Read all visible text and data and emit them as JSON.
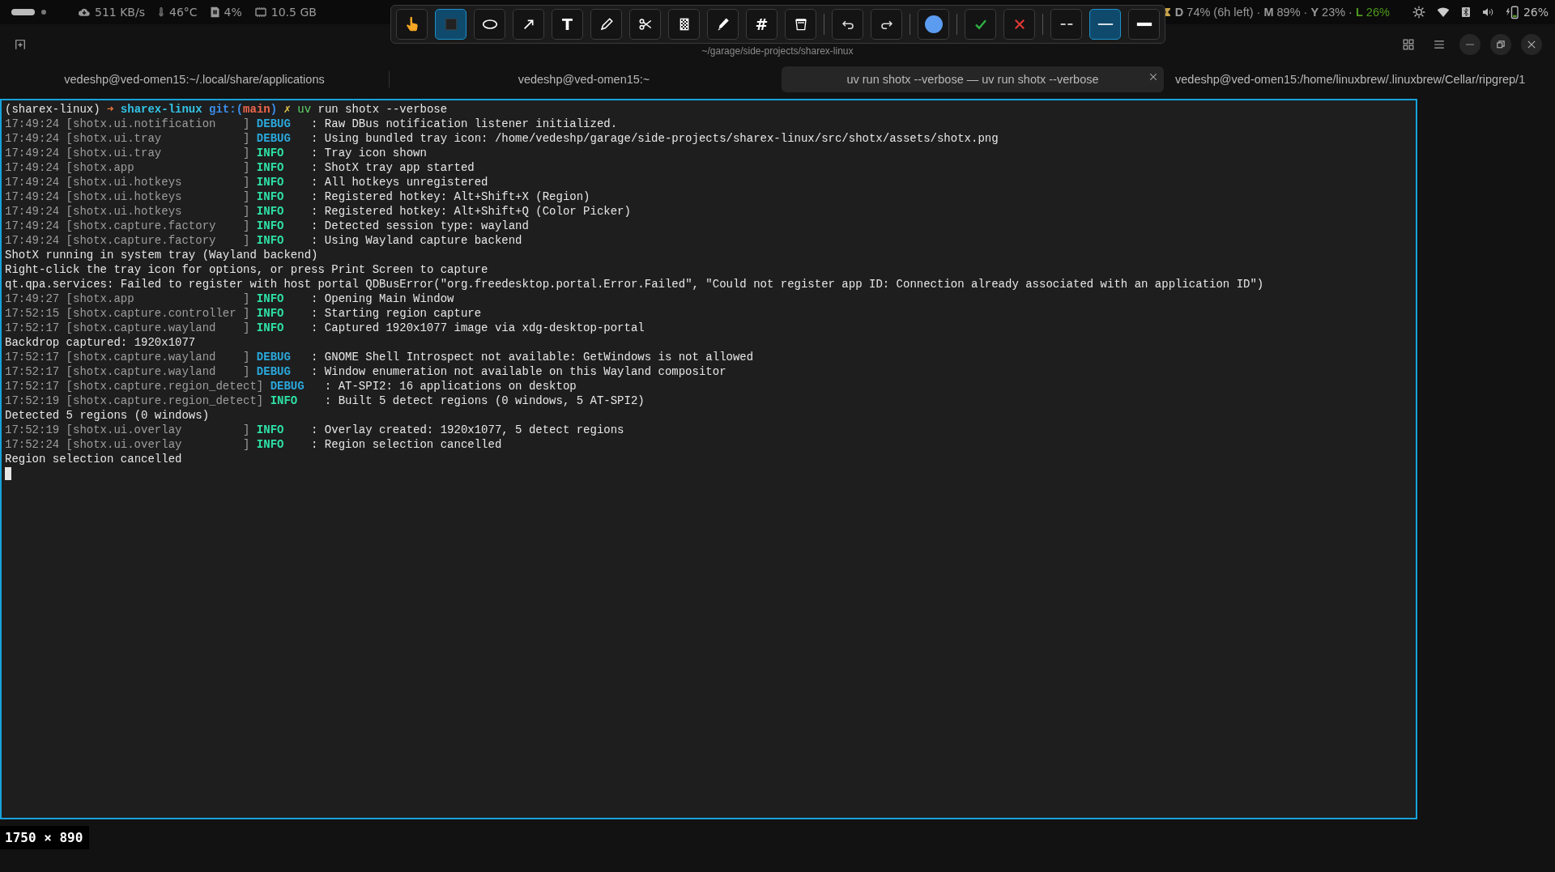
{
  "top_bar": {
    "left_stats": [
      {
        "kind": "network",
        "text": "511 KB/s"
      },
      {
        "kind": "temperature",
        "text": "46°C"
      },
      {
        "kind": "disk",
        "text": "4%"
      },
      {
        "kind": "memory",
        "text": "10.5 GB"
      }
    ],
    "usage": [
      {
        "label": "D",
        "value": "74% (6h left)",
        "color": "#9a9a9a"
      },
      {
        "label": "M",
        "value": "89%",
        "color": "#9a9a9a"
      },
      {
        "label": "Y",
        "value": "23%",
        "color": "#9a9a9a"
      },
      {
        "label": "L",
        "value": "26%",
        "color": "#4e9a1e"
      }
    ],
    "separator": "·",
    "tray": [
      {
        "kind": "brightness"
      },
      {
        "kind": "wifi"
      },
      {
        "kind": "bluetooth"
      },
      {
        "kind": "volume"
      },
      {
        "kind": "battery",
        "text": "26%"
      }
    ]
  },
  "toolbar": {
    "tools": [
      {
        "kind": "hand",
        "selected": false
      },
      {
        "kind": "rectangle",
        "selected": true
      },
      {
        "kind": "ellipse",
        "selected": false
      },
      {
        "kind": "arrow",
        "selected": false
      },
      {
        "kind": "text",
        "label": "T",
        "selected": false
      },
      {
        "kind": "pencil",
        "selected": false
      },
      {
        "kind": "scissors",
        "selected": false
      },
      {
        "kind": "pixelate",
        "selected": false
      },
      {
        "kind": "marker",
        "selected": false
      },
      {
        "kind": "number",
        "label": "#",
        "selected": false
      },
      {
        "kind": "trash",
        "selected": false
      },
      {
        "kind": "separator"
      },
      {
        "kind": "undo",
        "selected": false
      },
      {
        "kind": "redo",
        "selected": false
      },
      {
        "kind": "separator"
      },
      {
        "kind": "color",
        "color": "#5b9cf0",
        "selected": false
      },
      {
        "kind": "separator"
      },
      {
        "kind": "confirm",
        "selected": false
      },
      {
        "kind": "cancel",
        "selected": false
      },
      {
        "kind": "separator"
      },
      {
        "kind": "dashed",
        "selected": false
      },
      {
        "kind": "thin",
        "selected": true
      },
      {
        "kind": "thick",
        "selected": false
      }
    ]
  },
  "window": {
    "path": "~/garage/side-projects/sharex-linux",
    "controls": [
      {
        "kind": "grid"
      },
      {
        "kind": "menu"
      },
      {
        "kind": "minimize"
      },
      {
        "kind": "restore"
      },
      {
        "kind": "close"
      }
    ]
  },
  "tabs": [
    {
      "label": "vedeshp@ved-omen15:~/.local/share/applications",
      "selected": false
    },
    {
      "label": "vedeshp@ved-omen15:~",
      "selected": false
    },
    {
      "label": "uv run shotx --verbose — uv run shotx --verbose",
      "selected": true
    },
    {
      "label": "vedeshp@ved-omen15:/home/linuxbrew/.linuxbrew/Cellar/ripgrep/1",
      "selected": false
    }
  ],
  "terminal": {
    "lines": [
      {
        "kind": "prompt",
        "segments": [
          {
            "text": "(sharex-linux)",
            "color": "#e6e6e6"
          },
          {
            "text": "➜",
            "color": "#f0773a"
          },
          {
            "text": "sharex-linux",
            "color": "#33c4e8"
          },
          {
            "text": "git:(",
            "color": "#3b8eea"
          },
          {
            "text": "main",
            "color": "#f0664c",
            "joined": true
          },
          {
            "text": ")",
            "color": "#3b8eea",
            "joined": true
          },
          {
            "text": "✗",
            "color": "#e5c84a"
          },
          {
            "text": "uv",
            "color": "#5fd46a"
          },
          {
            "text": "run shotx --verbose",
            "color": "#e6e6e6"
          }
        ]
      },
      {
        "kind": "log",
        "time": "17:49:24",
        "logger": "[shotx.ui.notification    ]",
        "severity": "DEBUG",
        "color": "#2aa8dc",
        "message": ": Raw DBus notification listener initialized."
      },
      {
        "kind": "log",
        "time": "17:49:24",
        "logger": "[shotx.ui.tray            ]",
        "severity": "DEBUG",
        "color": "#2aa8dc",
        "message": ": Using bundled tray icon: /home/vedeshp/garage/side-projects/sharex-linux/src/shotx/assets/shotx.png"
      },
      {
        "kind": "log",
        "time": "17:49:24",
        "logger": "[shotx.ui.tray            ]",
        "severity": "INFO",
        "color": "#2ee0a6",
        "message": ": Tray icon shown"
      },
      {
        "kind": "log",
        "time": "17:49:24",
        "logger": "[shotx.app                ]",
        "severity": "INFO",
        "color": "#2ee0a6",
        "message": ": ShotX tray app started"
      },
      {
        "kind": "log",
        "time": "17:49:24",
        "logger": "[shotx.ui.hotkeys         ]",
        "severity": "INFO",
        "color": "#2ee0a6",
        "message": ": All hotkeys unregistered"
      },
      {
        "kind": "log",
        "time": "17:49:24",
        "logger": "[shotx.ui.hotkeys         ]",
        "severity": "INFO",
        "color": "#2ee0a6",
        "message": ": Registered hotkey: Alt+Shift+X (Region)"
      },
      {
        "kind": "log",
        "time": "17:49:24",
        "logger": "[shotx.ui.hotkeys         ]",
        "severity": "INFO",
        "color": "#2ee0a6",
        "message": ": Registered hotkey: Alt+Shift+Q (Color Picker)"
      },
      {
        "kind": "log",
        "time": "17:49:24",
        "logger": "[shotx.capture.factory    ]",
        "severity": "INFO",
        "color": "#2ee0a6",
        "message": ": Detected session type: wayland"
      },
      {
        "kind": "log",
        "time": "17:49:24",
        "logger": "[shotx.capture.factory    ]",
        "severity": "INFO",
        "color": "#2ee0a6",
        "message": ": Using Wayland capture backend"
      },
      {
        "kind": "plain",
        "text": "ShotX running in system tray (Wayland backend)"
      },
      {
        "kind": "plain",
        "text": "Right-click the tray icon for options, or press Print Screen to capture"
      },
      {
        "kind": "plain",
        "text": "qt.qpa.services: Failed to register with host portal QDBusError(\"org.freedesktop.portal.Error.Failed\", \"Could not register app ID: Connection already associated with an application ID\")"
      },
      {
        "kind": "log",
        "time": "17:49:27",
        "logger": "[shotx.app                ]",
        "severity": "INFO",
        "color": "#2ee0a6",
        "message": ": Opening Main Window"
      },
      {
        "kind": "log",
        "time": "17:52:15",
        "logger": "[shotx.capture.controller ]",
        "severity": "INFO",
        "color": "#2ee0a6",
        "message": ": Starting region capture"
      },
      {
        "kind": "log",
        "time": "17:52:17",
        "logger": "[shotx.capture.wayland    ]",
        "severity": "INFO",
        "color": "#2ee0a6",
        "message": ": Captured 1920x1077 image via xdg-desktop-portal"
      },
      {
        "kind": "plain",
        "text": "Backdrop captured: 1920x1077"
      },
      {
        "kind": "log",
        "time": "17:52:17",
        "logger": "[shotx.capture.wayland    ]",
        "severity": "DEBUG",
        "color": "#2aa8dc",
        "message": ": GNOME Shell Introspect not available: GetWindows is not allowed"
      },
      {
        "kind": "log",
        "time": "17:52:17",
        "logger": "[shotx.capture.wayland    ]",
        "severity": "DEBUG",
        "color": "#2aa8dc",
        "message": ": Window enumeration not available on this Wayland compositor"
      },
      {
        "kind": "log",
        "time": "17:52:17",
        "logger": "[shotx.capture.region_detect]",
        "severity": "DEBUG",
        "color": "#2aa8dc",
        "message": ": AT-SPI2: 16 applications on desktop"
      },
      {
        "kind": "log",
        "time": "17:52:19",
        "logger": "[shotx.capture.region_detect]",
        "severity": "INFO",
        "color": "#2ee0a6",
        "message": ": Built 5 detect regions (0 windows, 5 AT-SPI2)"
      },
      {
        "kind": "plain",
        "text": "Detected 5 regions (0 windows)"
      },
      {
        "kind": "log",
        "time": "17:52:19",
        "logger": "[shotx.ui.overlay         ]",
        "severity": "INFO",
        "color": "#2ee0a6",
        "message": ": Overlay created: 1920x1077, 5 detect regions"
      },
      {
        "kind": "log",
        "time": "17:52:24",
        "logger": "[shotx.ui.overlay         ]",
        "severity": "INFO",
        "color": "#2ee0a6",
        "message": ": Region selection cancelled"
      },
      {
        "kind": "plain",
        "text": "Region selection cancelled"
      },
      {
        "kind": "cursor"
      }
    ]
  },
  "selection": {
    "size": "1750 × 890"
  }
}
